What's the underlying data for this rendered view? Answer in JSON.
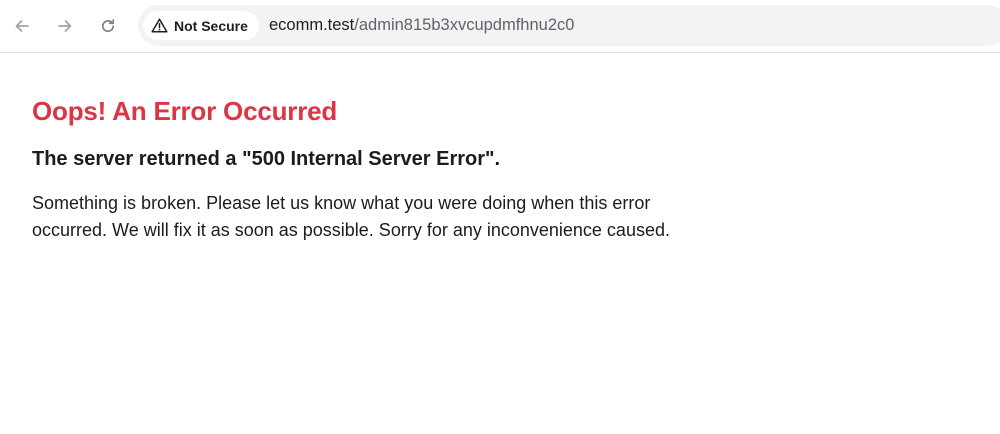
{
  "browser": {
    "security_chip": {
      "icon": "warning-triangle-icon",
      "label": "Not Secure"
    },
    "url": {
      "host": "ecomm.test",
      "path": "/admin815b3xvcupdmfhnu2c0"
    },
    "nav_icons": [
      "back-arrow-icon",
      "forward-arrow-icon",
      "reload-icon"
    ]
  },
  "page": {
    "title": "Oops! An Error Occurred",
    "subtitle": "The server returned a \"500 Internal Server Error\".",
    "message": "Something is broken. Please let us know what you were doing when this error occurred. We will fix it as soon as possible. Sorry for any inconvenience caused."
  },
  "colors": {
    "title": "#dc3545",
    "text": "#1c1c1c",
    "omnibox_bg": "#f1f3f4"
  }
}
